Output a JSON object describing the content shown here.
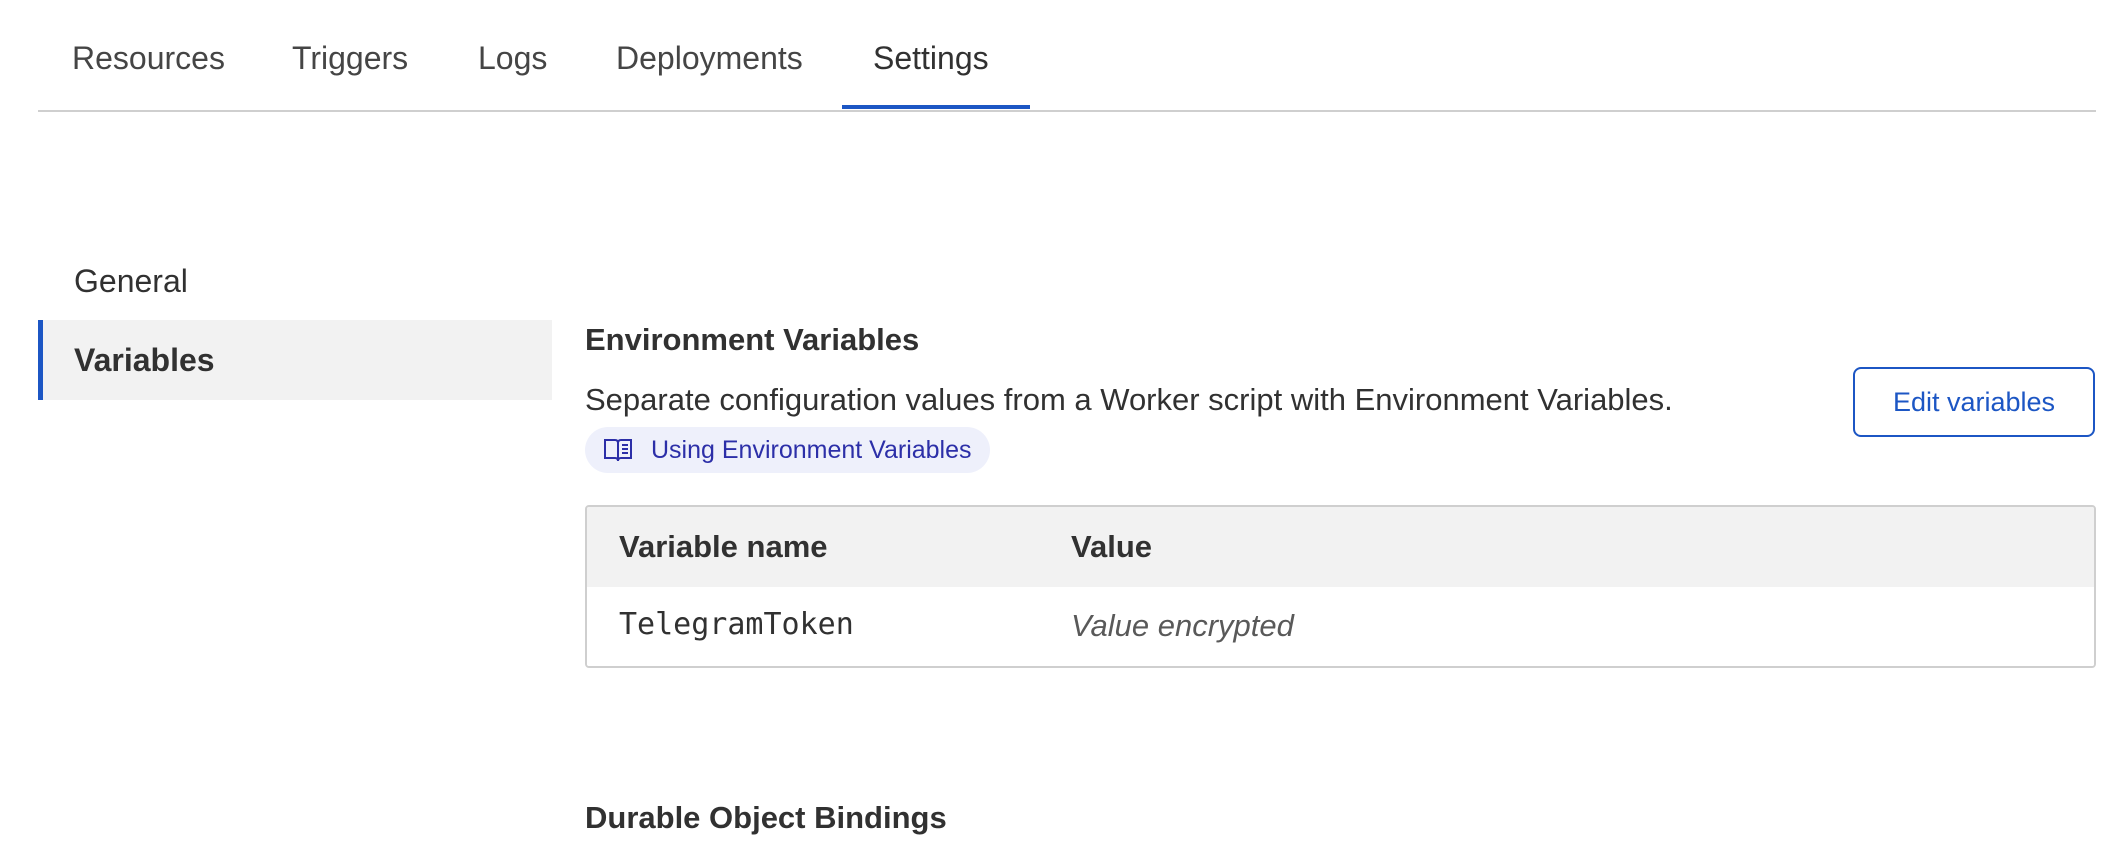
{
  "tabs": [
    {
      "label": "Resources",
      "active": false
    },
    {
      "label": "Triggers",
      "active": false
    },
    {
      "label": "Logs",
      "active": false
    },
    {
      "label": "Deployments",
      "active": false
    },
    {
      "label": "Settings",
      "active": true
    }
  ],
  "sidebar": {
    "items": [
      {
        "label": "General",
        "active": false
      },
      {
        "label": "Variables",
        "active": true
      }
    ]
  },
  "env_vars": {
    "title": "Environment Variables",
    "description": "Separate configuration values from a Worker script with Environment Variables.",
    "doc_link": {
      "label": "Using Environment Variables",
      "icon": "book-icon"
    },
    "edit_button": "Edit variables",
    "table": {
      "headers": [
        "Variable name",
        "Value"
      ],
      "rows": [
        {
          "name": "TelegramToken",
          "value": "Value encrypted"
        }
      ]
    }
  },
  "durable_objects": {
    "title": "Durable Object Bindings"
  },
  "colors": {
    "accent": "#1c56c4",
    "link": "#2c2fa8",
    "link_bg": "#eef0fb",
    "header_bg": "#f2f2f2",
    "border": "#cfcfcf"
  }
}
